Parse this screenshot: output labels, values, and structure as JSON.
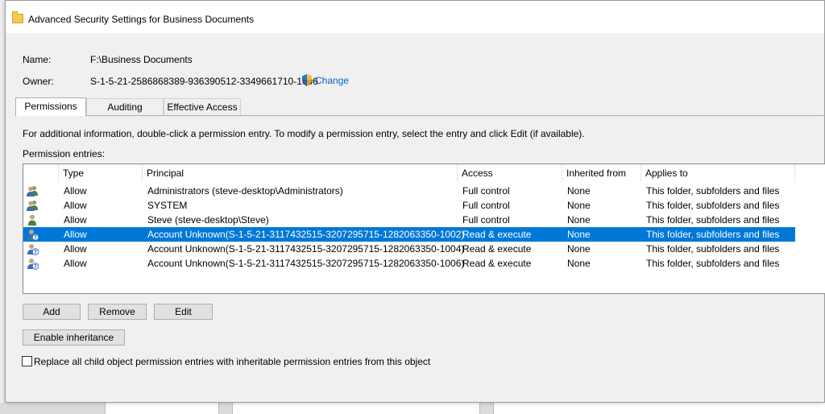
{
  "window": {
    "title": "Advanced Security Settings for Business Documents"
  },
  "info": {
    "name_label": "Name:",
    "name_value": "F:\\Business Documents",
    "owner_label": "Owner:",
    "owner_value": "S-1-5-21-2586868389-936390512-3349661710-1006",
    "change_label": "Change"
  },
  "tabs": [
    {
      "label": "Permissions",
      "active": true
    },
    {
      "label": "Auditing",
      "active": false
    },
    {
      "label": "Effective Access",
      "active": false
    }
  ],
  "instructions": "For additional information, double-click a permission entry. To modify a permission entry, select the entry and click Edit (if available).",
  "entries_label": "Permission entries:",
  "table": {
    "columns": [
      "Type",
      "Principal",
      "Access",
      "Inherited from",
      "Applies to"
    ],
    "rows": [
      {
        "icon": "group-users-icon",
        "type": "Allow",
        "principal": "Administrators (steve-desktop\\Administrators)",
        "access": "Full control",
        "inherited": "None",
        "applies": "This folder, subfolders and files",
        "selected": false
      },
      {
        "icon": "group-users-icon",
        "type": "Allow",
        "principal": "SYSTEM",
        "access": "Full control",
        "inherited": "None",
        "applies": "This folder, subfolders and files",
        "selected": false
      },
      {
        "icon": "user-icon",
        "type": "Allow",
        "principal": "Steve (steve-desktop\\Steve)",
        "access": "Full control",
        "inherited": "None",
        "applies": "This folder, subfolders and files",
        "selected": false
      },
      {
        "icon": "unknown-user-icon",
        "type": "Allow",
        "principal": "Account Unknown(S-1-5-21-3117432515-3207295715-1282063350-1002)",
        "access": "Read & execute",
        "inherited": "None",
        "applies": "This folder, subfolders and files",
        "selected": true
      },
      {
        "icon": "unknown-user-icon",
        "type": "Allow",
        "principal": "Account Unknown(S-1-5-21-3117432515-3207295715-1282063350-1004)",
        "access": "Read & execute",
        "inherited": "None",
        "applies": "This folder, subfolders and files",
        "selected": false
      },
      {
        "icon": "unknown-user-icon",
        "type": "Allow",
        "principal": "Account Unknown(S-1-5-21-3117432515-3207295715-1282063350-1006)",
        "access": "Read & execute",
        "inherited": "None",
        "applies": "This folder, subfolders and files",
        "selected": false
      }
    ]
  },
  "buttons": {
    "add": "Add",
    "remove": "Remove",
    "edit": "Edit",
    "enable_inheritance": "Enable inheritance"
  },
  "replace_checkbox": {
    "label": "Replace all child object permission entries with inheritable permission entries from this object",
    "checked": false
  },
  "colors": {
    "selection": "#0078d7",
    "link": "#0066cc"
  }
}
